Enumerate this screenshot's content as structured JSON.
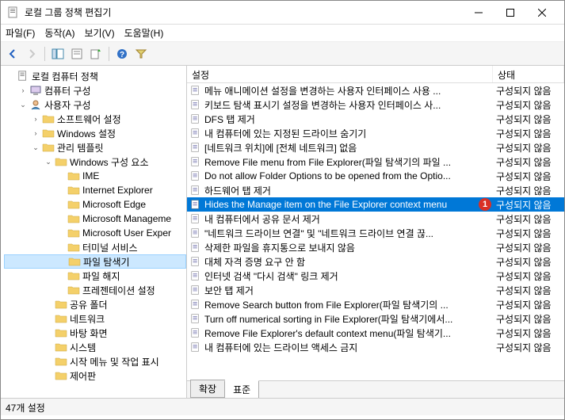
{
  "window": {
    "title": "로컬 그룹 정책 편집기"
  },
  "menu": {
    "file": "파일(F)",
    "action": "동작(A)",
    "view": "보기(V)",
    "help": "도움말(H)"
  },
  "tree": [
    {
      "indent": 0,
      "exp": "none",
      "icon": "policy",
      "label": "로컬 컴퓨터 정책"
    },
    {
      "indent": 1,
      "exp": "right",
      "icon": "computer",
      "label": "컴퓨터 구성"
    },
    {
      "indent": 1,
      "exp": "down",
      "icon": "user",
      "label": "사용자 구성"
    },
    {
      "indent": 2,
      "exp": "right",
      "icon": "folder",
      "label": "소프트웨어 설정"
    },
    {
      "indent": 2,
      "exp": "right",
      "icon": "folder",
      "label": "Windows 설정"
    },
    {
      "indent": 2,
      "exp": "down",
      "icon": "folder",
      "label": "관리 템플릿"
    },
    {
      "indent": 3,
      "exp": "down",
      "icon": "folder",
      "label": "Windows 구성 요소"
    },
    {
      "indent": 4,
      "exp": "none",
      "icon": "folder",
      "label": "IME"
    },
    {
      "indent": 4,
      "exp": "none",
      "icon": "folder",
      "label": "Internet Explorer"
    },
    {
      "indent": 4,
      "exp": "none",
      "icon": "folder",
      "label": "Microsoft Edge"
    },
    {
      "indent": 4,
      "exp": "none",
      "icon": "folder",
      "label": "Microsoft Manageme"
    },
    {
      "indent": 4,
      "exp": "none",
      "icon": "folder",
      "label": "Microsoft User Exper"
    },
    {
      "indent": 4,
      "exp": "none",
      "icon": "folder",
      "label": "터미널 서비스"
    },
    {
      "indent": 4,
      "exp": "none",
      "icon": "folder",
      "label": "파일 탐색기",
      "selected": true
    },
    {
      "indent": 4,
      "exp": "none",
      "icon": "folder",
      "label": "파일 해지"
    },
    {
      "indent": 4,
      "exp": "none",
      "icon": "folder",
      "label": "프레젠테이션 설정"
    },
    {
      "indent": 3,
      "exp": "none",
      "icon": "folder",
      "label": "공유 폴더"
    },
    {
      "indent": 3,
      "exp": "none",
      "icon": "folder",
      "label": "네트워크"
    },
    {
      "indent": 3,
      "exp": "none",
      "icon": "folder",
      "label": "바탕 화면"
    },
    {
      "indent": 3,
      "exp": "none",
      "icon": "folder",
      "label": "시스템"
    },
    {
      "indent": 3,
      "exp": "none",
      "icon": "folder",
      "label": "시작 메뉴 및 작업 표시"
    },
    {
      "indent": 3,
      "exp": "none",
      "icon": "folder",
      "label": "제어판"
    }
  ],
  "list": {
    "columns": {
      "setting": "설정",
      "status": "상태"
    },
    "rows": [
      {
        "label": "메뉴 애니메이션 설정을 변경하는 사용자 인터페이스 사용 ...",
        "status": "구성되지 않음"
      },
      {
        "label": "키보드 탐색 표시기 설정을 변경하는 사용자 인터페이스 사...",
        "status": "구성되지 않음"
      },
      {
        "label": "DFS 탭 제거",
        "status": "구성되지 않음"
      },
      {
        "label": "내 컴퓨터에 있는 지정된 드라이브 숨기기",
        "status": "구성되지 않음"
      },
      {
        "label": "[네트워크 위치]에 [전체 네트워크] 없음",
        "status": "구성되지 않음"
      },
      {
        "label": "Remove File menu from File Explorer(파일 탐색기의 파일 ...",
        "status": "구성되지 않음"
      },
      {
        "label": "Do not allow Folder Options to be opened from the Optio...",
        "status": "구성되지 않음"
      },
      {
        "label": "하드웨어 탭 제거",
        "status": "구성되지 않음"
      },
      {
        "label": "Hides the Manage item on the File Explorer context menu",
        "status": "구성되지 않음",
        "selected": true,
        "marker": 1
      },
      {
        "label": "내 컴퓨터에서 공유 문서 제거",
        "status": "구성되지 않음"
      },
      {
        "label": "\"네트워크 드라이브 연결\" 및 \"네트워크 드라이브 연결 끊...",
        "status": "구성되지 않음"
      },
      {
        "label": "삭제한 파일을 휴지통으로 보내지 않음",
        "status": "구성되지 않음"
      },
      {
        "label": "대체 자격 증명 요구 안 함",
        "status": "구성되지 않음"
      },
      {
        "label": "인터넷 검색 \"다시 검색\" 링크 제거",
        "status": "구성되지 않음"
      },
      {
        "label": "보안 탭 제거",
        "status": "구성되지 않음"
      },
      {
        "label": "Remove Search button from File Explorer(파일 탐색기의 ...",
        "status": "구성되지 않음"
      },
      {
        "label": "Turn off numerical sorting in File Explorer(파일 탐색기에서...",
        "status": "구성되지 않음"
      },
      {
        "label": "Remove File Explorer's default context menu(파일 탐색기...",
        "status": "구성되지 않음"
      },
      {
        "label": "내 컴퓨터에 있는 드라이브 액세스 금지",
        "status": "구성되지 않음"
      }
    ]
  },
  "tabs": {
    "extended": "확장",
    "standard": "표준"
  },
  "statusbar": "47개 설정"
}
